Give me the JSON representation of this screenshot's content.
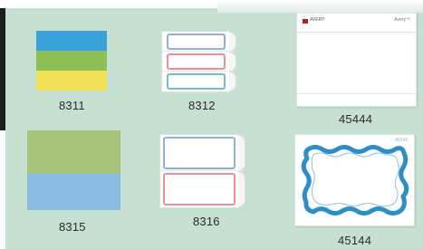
{
  "products": [
    {
      "id": "8311",
      "colors": [
        "#3ba2d9",
        "#8dbf54",
        "#f1e257"
      ]
    },
    {
      "id": "8312",
      "border_colors": [
        "#8fb0dd",
        "#ee8e99",
        "#69c4c2"
      ]
    },
    {
      "id": "45444",
      "brand_text": "AVERY",
      "corner_text": "Avery™"
    },
    {
      "id": "8315",
      "colors": [
        "#a8c47b",
        "#8bbbe0"
      ]
    },
    {
      "id": "8316",
      "border_colors": [
        "#8fb0dd",
        "#ee8e99"
      ]
    },
    {
      "id": "45144",
      "corner_text": "45144",
      "border_color": "#2f8dc9"
    }
  ],
  "colors": {
    "background": "#c6e0d2",
    "caption": "#2b2b2b"
  }
}
